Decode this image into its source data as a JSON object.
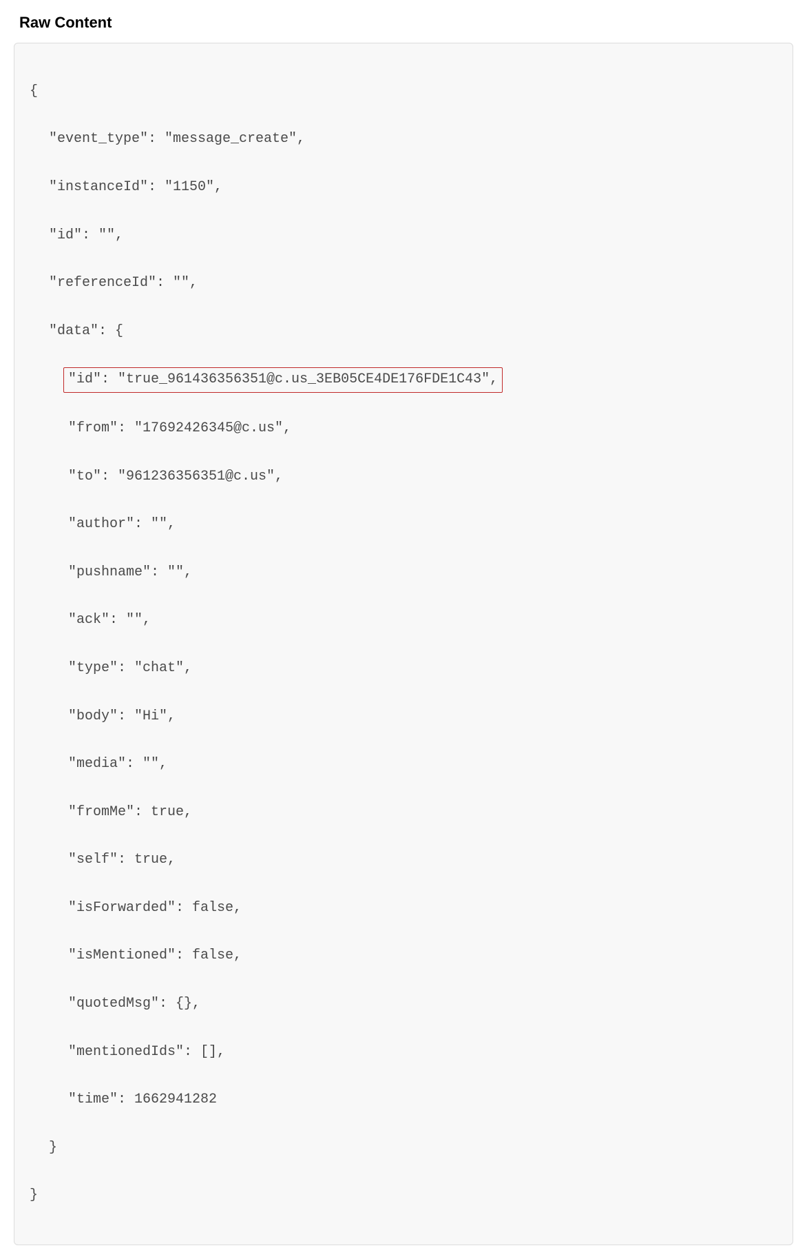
{
  "heading": "Raw Content",
  "payload": {
    "event_type": "message_create",
    "instanceId": "1150",
    "id": "",
    "referenceId": "",
    "data": {
      "id": "true_961436356351@c.us_3EB05CE4DE176FDE1C43",
      "from": "17692426345@c.us",
      "to": "961236356351@c.us",
      "author": "",
      "pushname": "",
      "ack": "",
      "type": "chat",
      "body": "Hi",
      "media": "",
      "fromMe": "true",
      "self": "true",
      "isForwarded": "false",
      "isMentioned": "false",
      "quotedMsg": "{}",
      "mentionedIds": "[]",
      "time": "1662941282"
    }
  },
  "lines": {
    "open_brace": "{",
    "event_type": "\"event_type\": \"message_create\",",
    "instanceId": "\"instanceId\": \"1150\",",
    "id": "\"id\": \"\",",
    "referenceId": "\"referenceId\": \"\",",
    "data_open": "\"data\": {",
    "data_id": "\"id\": \"true_961436356351@c.us_3EB05CE4DE176FDE1C43\",",
    "data_from": "\"from\": \"17692426345@c.us\",",
    "data_to": "\"to\": \"961236356351@c.us\",",
    "data_author": "\"author\": \"\",",
    "data_pushname": "\"pushname\": \"\",",
    "data_ack": "\"ack\": \"\",",
    "data_type": "\"type\": \"chat\",",
    "data_body": "\"body\": \"Hi\",",
    "data_media": "\"media\": \"\",",
    "data_fromMe": "\"fromMe\": true,",
    "data_self": "\"self\": true,",
    "data_isForwarded": "\"isForwarded\": false,",
    "data_isMentioned": "\"isMentioned\": false,",
    "data_quotedMsg": "\"quotedMsg\": {},",
    "data_mentionedIds": "\"mentionedIds\": [],",
    "data_time": "\"time\": 1662941282",
    "data_close": "}",
    "close_brace": "}"
  }
}
